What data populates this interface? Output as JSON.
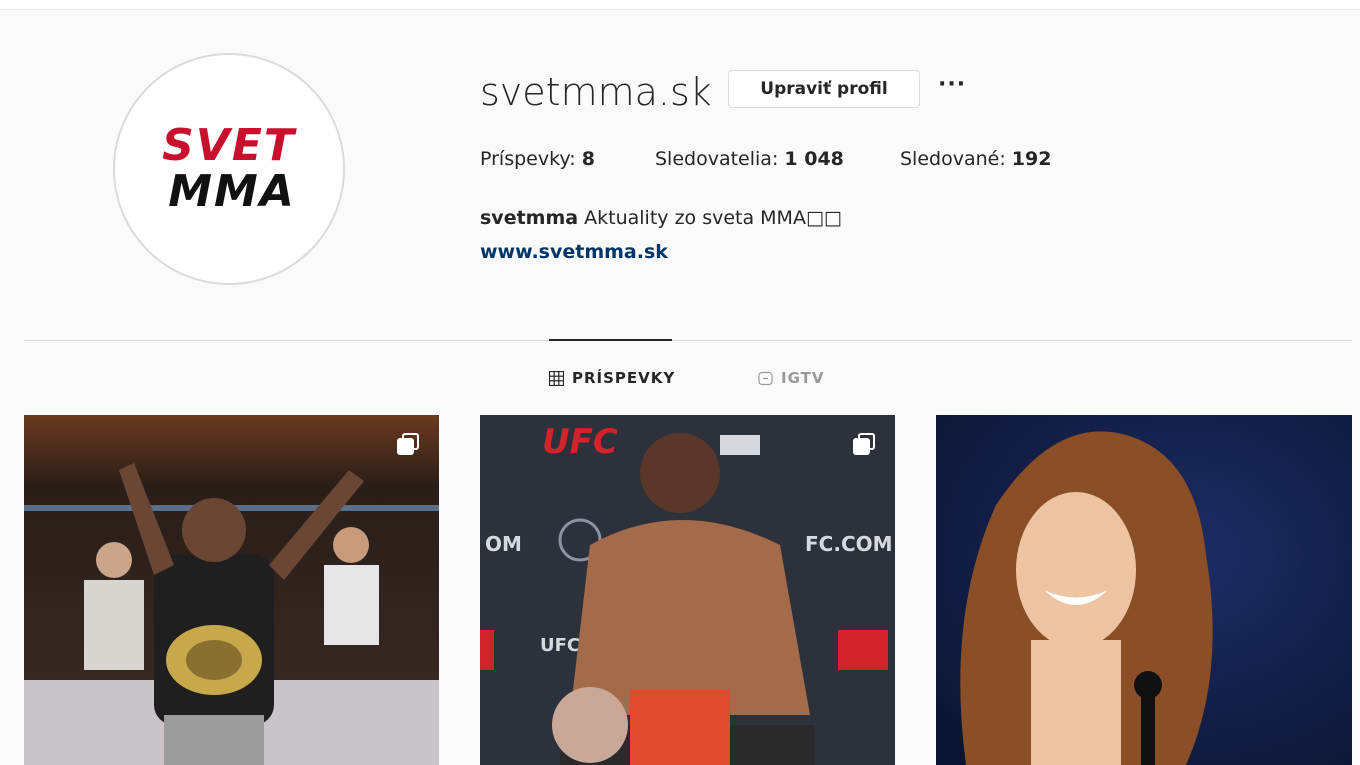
{
  "profile": {
    "username": "svetmma.sk",
    "edit_label": "Upraviť profil",
    "more_label": "···",
    "logo": {
      "line1": "SVET",
      "line2": "MMA"
    },
    "stats": {
      "posts_label": "Príspevky:",
      "posts_value": "8",
      "followers_label": "Sledovatelia:",
      "followers_value": "1 048",
      "following_label": "Sledované:",
      "following_value": "192"
    },
    "bio_name": "svetmma",
    "bio_text": "Aktuality zo sveta MMA□□",
    "link": "www.svetmma.sk"
  },
  "tabs": [
    {
      "label": "PRÍSPEVKY",
      "icon": "grid-icon",
      "active": true
    },
    {
      "label": "IGTV",
      "icon": "igtv-icon",
      "active": false
    }
  ],
  "posts": [
    {
      "icon": "multiple-images-icon",
      "caption_visible": ""
    },
    {
      "icon": "multiple-images-icon",
      "caption_visible": "UFC"
    },
    {
      "icon": "",
      "caption_visible": ""
    }
  ],
  "colors": {
    "link": "#003569",
    "logo_red": "#c8102e",
    "background": "#fafafa"
  }
}
